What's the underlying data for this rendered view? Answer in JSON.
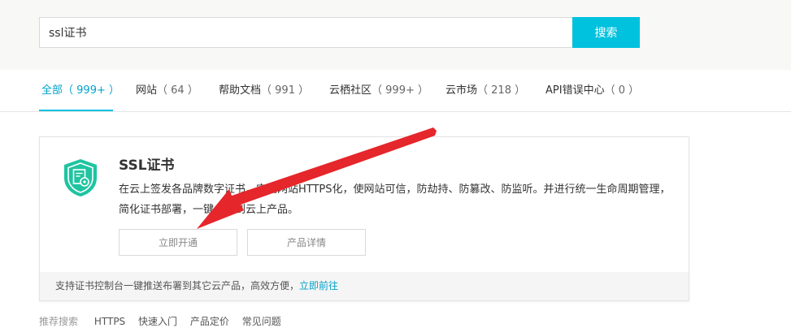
{
  "search": {
    "value": "ssl证书",
    "button_label": "搜索"
  },
  "tabs": [
    {
      "label": "全部",
      "count": "（ 999+ ）",
      "active": true
    },
    {
      "label": "网站",
      "count": "（ 64 ）"
    },
    {
      "label": "帮助文档",
      "count": "（ 991 ）"
    },
    {
      "label": "云栖社区",
      "count": "（ 999+ ）"
    },
    {
      "label": "云市场",
      "count": "（ 218 ）"
    },
    {
      "label": "API错误中心",
      "count": "（ 0 ）"
    }
  ],
  "result": {
    "icon": "ssl-certificate-shield-icon",
    "title": "SSL证书",
    "description": "在云上签发各品牌数字证书，实现网站HTTPS化，使网站可信，防劫持、防篡改、防监听。并进行统一生命周期管理，简化证书部署，一键分发到云上产品。",
    "primary_button": "立即开通",
    "secondary_button": "产品详情",
    "footer_text": "支持证书控制台一键推送布署到其它云产品，高效方便，",
    "footer_link": "立即前往"
  },
  "recommend": {
    "label": "推荐搜索",
    "links": [
      "HTTPS",
      "快速入门",
      "产品定价",
      "常见问题"
    ]
  },
  "colors": {
    "accent": "#00c1de",
    "link": "#00a2ca",
    "icon_green": "#1fc4a1",
    "annotation_arrow": "#e5262b"
  }
}
